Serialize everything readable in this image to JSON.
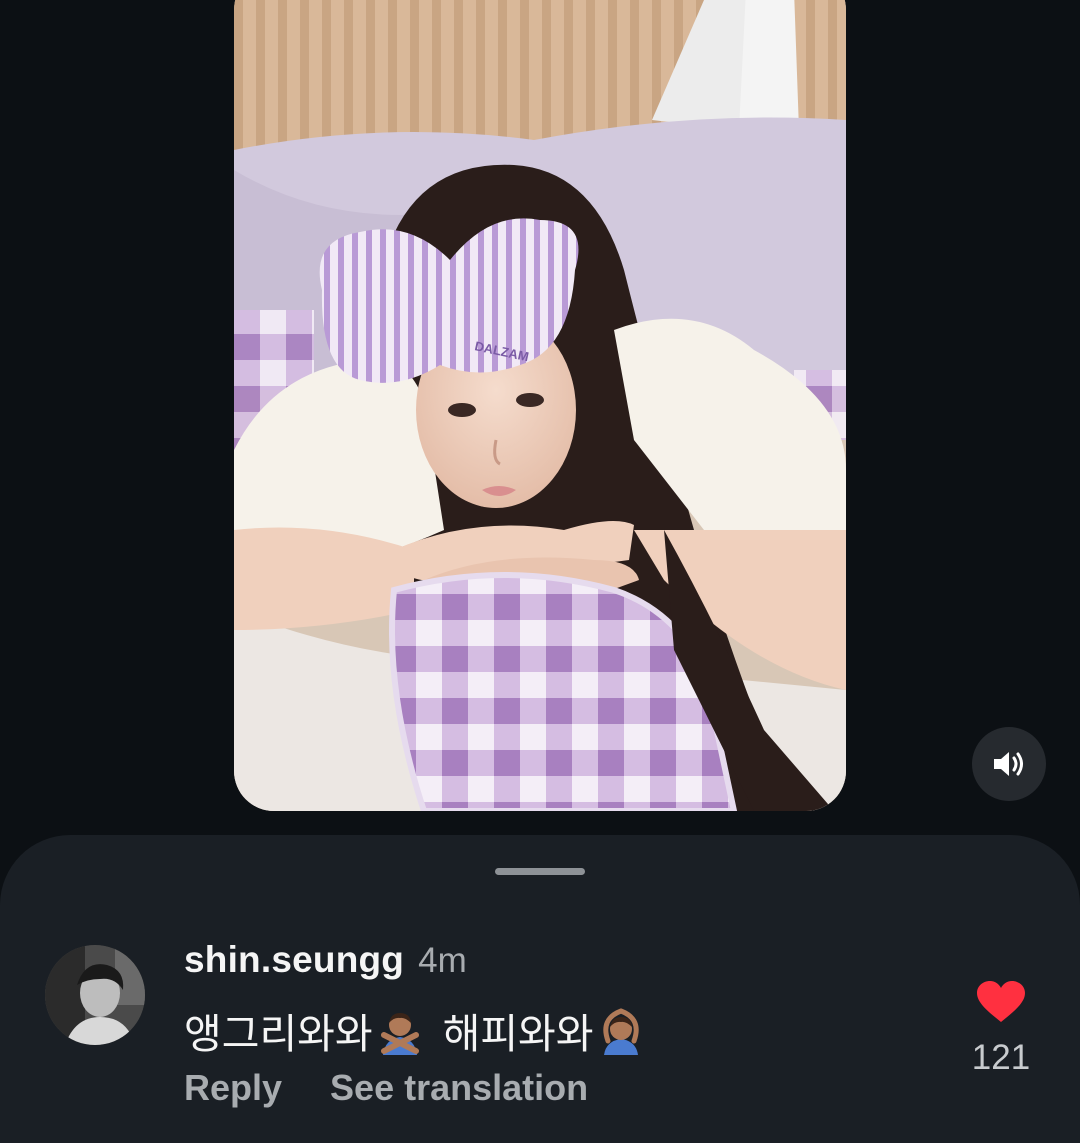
{
  "media": {
    "mask_text": "DALZAM",
    "accent_colors": {
      "mask": "#b99ad6",
      "pillow": "#b08ac6",
      "bedding": "#d2c9dd",
      "background": "#0c1014",
      "sheet": "#1a1f25",
      "like": "#ff3040"
    }
  },
  "sound_button": {
    "icon": "speaker-on-icon"
  },
  "comment": {
    "username": "shin.seungg",
    "time": "4m",
    "text_part1": "앵그리와와",
    "emoji1": "person-gesturing-no-icon",
    "text_part2": "해피와와",
    "emoji2": "person-gesturing-ok-icon",
    "reply_label": "Reply",
    "translate_label": "See translation",
    "like_icon": "heart-filled-icon",
    "like_count": "121"
  }
}
